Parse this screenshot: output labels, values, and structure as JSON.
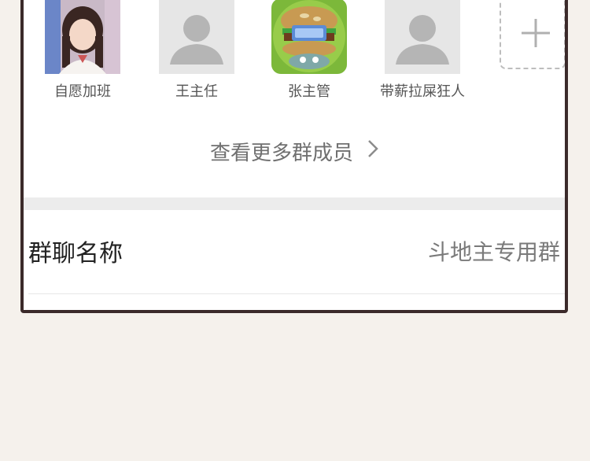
{
  "members": [
    {
      "name": "自愿加班",
      "avatar": "photo-avatar"
    },
    {
      "name": "王主任",
      "avatar": "default-person-icon"
    },
    {
      "name": "张主管",
      "avatar": "burger-avatar"
    },
    {
      "name": "带薪拉屎狂人",
      "avatar": "default-person-icon"
    }
  ],
  "add_member_icon": "plus-icon",
  "view_more": {
    "label": "查看更多群成员",
    "icon": "chevron-right-icon"
  },
  "group_name_row": {
    "label": "群聊名称",
    "value": "斗地主专用群"
  },
  "colors": {
    "page_bg": "#f5f1ec",
    "panel_border": "#3b2a2a",
    "separator": "#ececec"
  }
}
